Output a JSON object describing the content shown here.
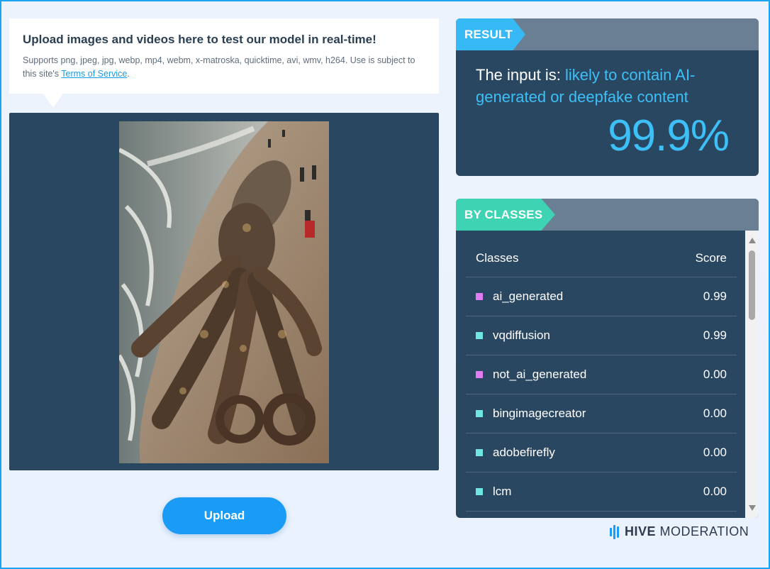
{
  "upload_info": {
    "title": "Upload images and videos here to test our model in real-time!",
    "subtitle": "Supports png, jpeg, jpg, webp, mp4, webm, x-matroska, quicktime, avi, wmv, h264. Use is subject to this site's ",
    "tos_link": "Terms of Service",
    "tos_suffix": "."
  },
  "preview": {
    "description_icon": "image-preview"
  },
  "upload_button": {
    "label": "Upload"
  },
  "result": {
    "tab_label": "RESULT",
    "prefix": "The input is: ",
    "verdict": "likely to contain AI-generated or deepfake content",
    "confidence": "99.9%"
  },
  "classes": {
    "tab_label": "BY CLASSES",
    "col_class": "Classes",
    "col_score": "Score",
    "rows": [
      {
        "name": "ai_generated",
        "score": "0.99",
        "color": "#e27cf2"
      },
      {
        "name": "vqdiffusion",
        "score": "0.99",
        "color": "#6fe6e0"
      },
      {
        "name": "not_ai_generated",
        "score": "0.00",
        "color": "#e27cf2"
      },
      {
        "name": "bingimagecreator",
        "score": "0.00",
        "color": "#6fe6e0"
      },
      {
        "name": "adobefirefly",
        "score": "0.00",
        "color": "#6fe6e0"
      },
      {
        "name": "lcm",
        "score": "0.00",
        "color": "#6fe6e0"
      }
    ]
  },
  "brand": {
    "bold": "HIVE",
    "rest": "MODERATION"
  },
  "colors": {
    "accent": "#1a9cf6",
    "panel": "#2a4761",
    "highlight": "#3dbff7",
    "classes_tab": "#3ed3b3"
  }
}
